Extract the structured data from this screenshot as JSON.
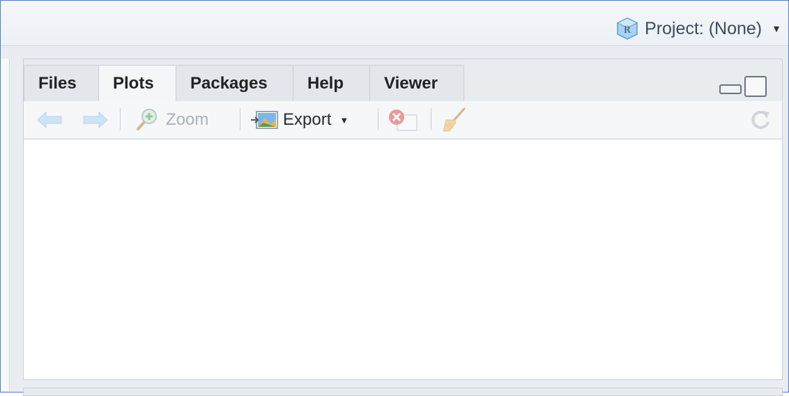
{
  "header": {
    "project_label": "Project: (None)",
    "project_icon": "r-project-icon"
  },
  "pane": {
    "tabs": [
      {
        "label": "Files",
        "active": false
      },
      {
        "label": "Plots",
        "active": true
      },
      {
        "label": "Packages",
        "active": false
      },
      {
        "label": "Help",
        "active": false
      },
      {
        "label": "Viewer",
        "active": false
      }
    ],
    "toolbar": {
      "zoom_label": "Zoom",
      "export_label": "Export"
    }
  },
  "colors": {
    "frame_border": "#4a7fc1",
    "disabled_text": "#a8b1bb",
    "pane_border": "#c7ced6"
  }
}
